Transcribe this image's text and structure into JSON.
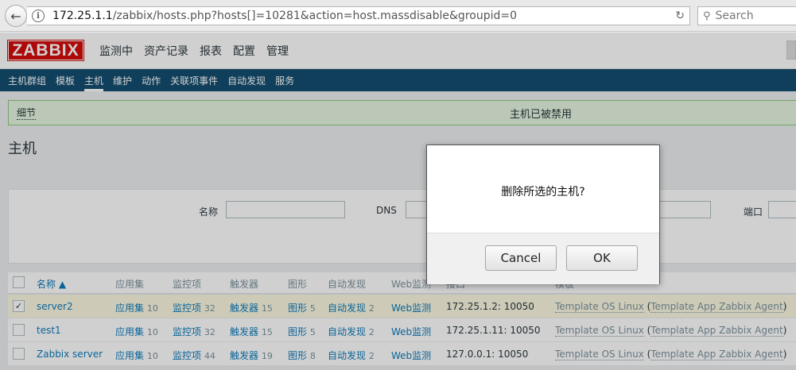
{
  "browser": {
    "url_host": "172.25.1.1",
    "url_path": "/zabbix/hosts.php?hosts[]=10281&action=host.massdisable&groupid=0",
    "search_placeholder": "Search"
  },
  "header": {
    "logo": "ZABBIX",
    "menu": [
      "监测中",
      "资产记录",
      "报表",
      "配置",
      "管理"
    ],
    "active_menu": "配置"
  },
  "subnav": {
    "items": [
      "主机群组",
      "模板",
      "主机",
      "维护",
      "动作",
      "关联项事件",
      "自动发现",
      "服务"
    ],
    "active": "主机"
  },
  "message": {
    "details": "细节",
    "text": "主机已被禁用"
  },
  "page_title": "主机",
  "filter": {
    "name_label": "名称",
    "dns_label": "DNS",
    "port_label": "端口"
  },
  "table": {
    "headers": {
      "name": "名称 ▲",
      "apps": "应用集",
      "items": "监控项",
      "triggers": "触发器",
      "graphs": "图形",
      "discovery": "自动发现",
      "web": "Web监测",
      "interface": "接口",
      "templates": "模板"
    },
    "rows": [
      {
        "checked": true,
        "name": "server2",
        "apps_label": "应用集",
        "apps_count": "10",
        "items_label": "监控项",
        "items_count": "32",
        "triggers_label": "触发器",
        "triggers_count": "15",
        "graphs_label": "图形",
        "graphs_count": "5",
        "discovery_label": "自动发现",
        "discovery_count": "2",
        "web": "Web监测",
        "interface": "172.25.1.2: 10050",
        "template": "Template OS Linux",
        "template_sub": "Template App Zabbix Agent"
      },
      {
        "checked": false,
        "name": "test1",
        "apps_label": "应用集",
        "apps_count": "10",
        "items_label": "监控项",
        "items_count": "32",
        "triggers_label": "触发器",
        "triggers_count": "15",
        "graphs_label": "图形",
        "graphs_count": "5",
        "discovery_label": "自动发现",
        "discovery_count": "2",
        "web": "Web监测",
        "interface": "172.25.1.11: 10050",
        "template": "Template OS Linux",
        "template_sub": "Template App Zabbix Agent"
      },
      {
        "checked": false,
        "name": "Zabbix server",
        "apps_label": "应用集",
        "apps_count": "10",
        "items_label": "监控项",
        "items_count": "44",
        "triggers_label": "触发器",
        "triggers_count": "19",
        "graphs_label": "图形",
        "graphs_count": "8",
        "discovery_label": "自动发现",
        "discovery_count": "2",
        "web": "Web监测",
        "interface": "127.0.0.1: 10050",
        "template": "Template OS Linux",
        "template_sub": "Template App Zabbix Agent"
      }
    ]
  },
  "dialog": {
    "message": "删除所选的主机?",
    "cancel_label": "Cancel",
    "ok_label": "OK"
  },
  "colors": {
    "brand": "#d40000",
    "nav": "#0a466a",
    "link": "#0275b8",
    "success_bg": "#e5f5df"
  }
}
